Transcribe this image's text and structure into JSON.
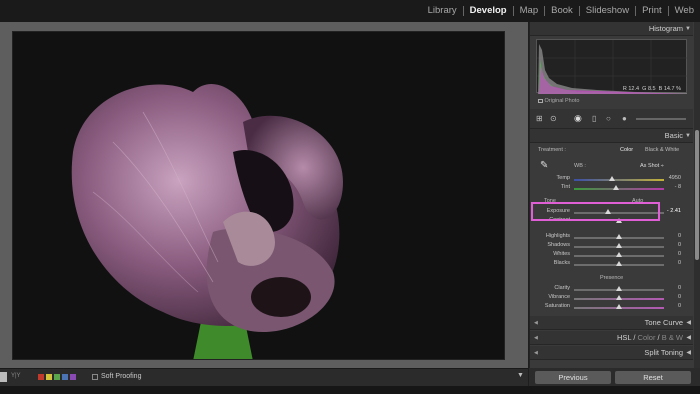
{
  "modules": [
    "Library",
    "Develop",
    "Map",
    "Book",
    "Slideshow",
    "Print",
    "Web"
  ],
  "active_module": "Develop",
  "panel": {
    "histogram_title": "Histogram",
    "rgb": {
      "r_label": "R",
      "r": "12.4",
      "g_label": "G",
      "g": "8.5",
      "b_label": "B",
      "b": "14.7",
      "unit": "%"
    },
    "original_photo_label": "Original Photo",
    "basic_title": "Basic",
    "treatment_label": "Treatment :",
    "color_label": "Color",
    "bw_label": "Black & White",
    "wb_label": "WB :",
    "wb_value": "As Shot ÷",
    "temp": {
      "label": "Temp",
      "value": "4950",
      "level": 0.42
    },
    "tint": {
      "label": "Tint",
      "value": "- 8",
      "level": 0.47
    },
    "tone_label": "Tone",
    "auto_label": "Auto",
    "exposure": {
      "label": "Exposure",
      "value": "- 2.41",
      "level": 0.38
    },
    "contrast": {
      "label": "Contrast",
      "level": 0.5
    },
    "highlights": {
      "label": "Highlights",
      "value": "0",
      "level": 0.5
    },
    "shadows": {
      "label": "Shadows",
      "value": "0",
      "level": 0.5
    },
    "whites": {
      "label": "Whites",
      "value": "0",
      "level": 0.5
    },
    "blacks": {
      "label": "Blacks",
      "value": "0",
      "level": 0.5
    },
    "presence_label": "Presence",
    "clarity": {
      "label": "Clarity",
      "value": "0",
      "level": 0.5
    },
    "vibrance": {
      "label": "Vibrance",
      "value": "0",
      "level": 0.5
    },
    "saturation": {
      "label": "Saturation",
      "value": "0",
      "level": 0.5
    },
    "tone_curve_title": "Tone Curve",
    "hsl_title": "HSL",
    "color_title": "Color",
    "bw_title": "B & W",
    "split_toning_title": "Split Toning"
  },
  "buttons": {
    "previous": "Previous",
    "reset": "Reset"
  },
  "toolbar": {
    "soft_proofing": "Soft Proofing"
  },
  "colors": {
    "highlight_box": "#e05ed6"
  }
}
